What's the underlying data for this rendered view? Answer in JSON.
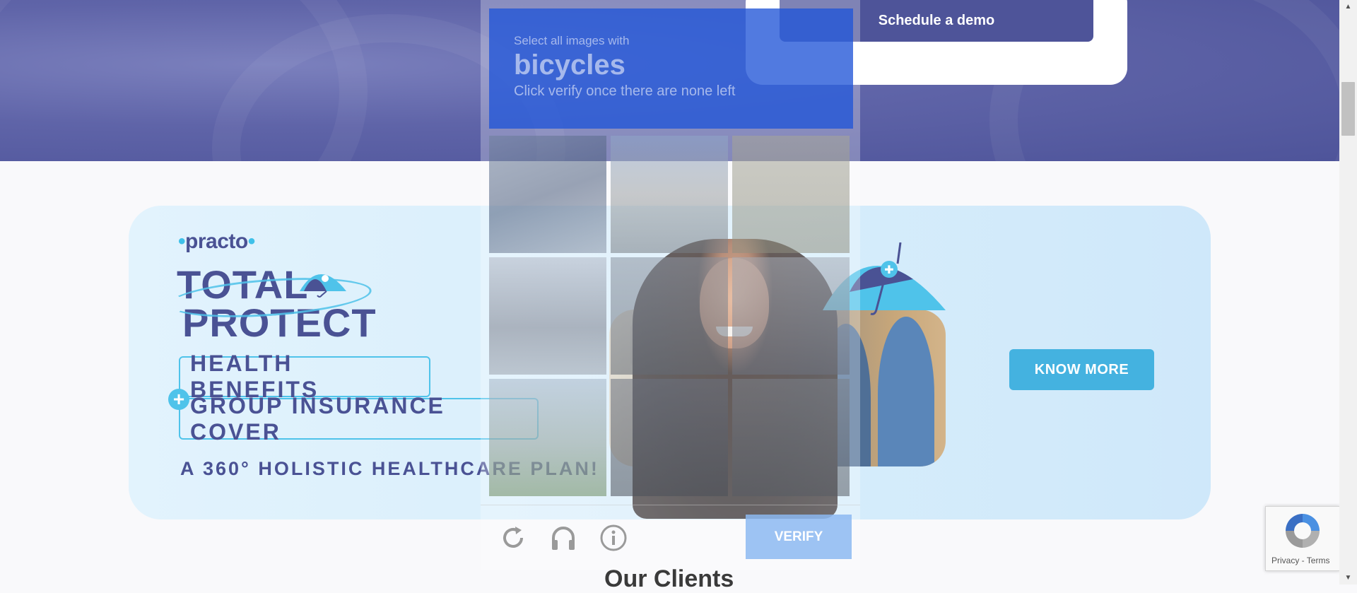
{
  "header": {
    "demo_label": "Schedule a demo"
  },
  "banner": {
    "brand": "practo",
    "title_line1": "TOTAL",
    "title_line2": "PROTECT",
    "benefit1": "HEALTH BENEFITS",
    "benefit2": "GROUP INSURANCE COVER",
    "tagline": "A 360° HOLISTIC HEALTHCARE PLAN!",
    "cta": "KNOW MORE"
  },
  "section": {
    "clients_heading": "Our Clients"
  },
  "captcha": {
    "instruction": "Select all images with",
    "keyword": "bicycles",
    "hint": "Click verify once there are none left",
    "verify_label": "VERIFY",
    "tiles": [
      "tile-1",
      "tile-2",
      "tile-3",
      "tile-4",
      "tile-5",
      "tile-6",
      "tile-7",
      "tile-8",
      "tile-9"
    ],
    "icons": [
      "reload-icon",
      "audio-icon",
      "info-icon"
    ]
  },
  "recaptcha_badge": {
    "privacy": "Privacy",
    "separator": " - ",
    "terms": "Terms"
  },
  "colors": {
    "brand": "#4a5294",
    "accent": "#44b2e0",
    "hero": "#5f64a8",
    "captcha_header": "#2055d7"
  }
}
